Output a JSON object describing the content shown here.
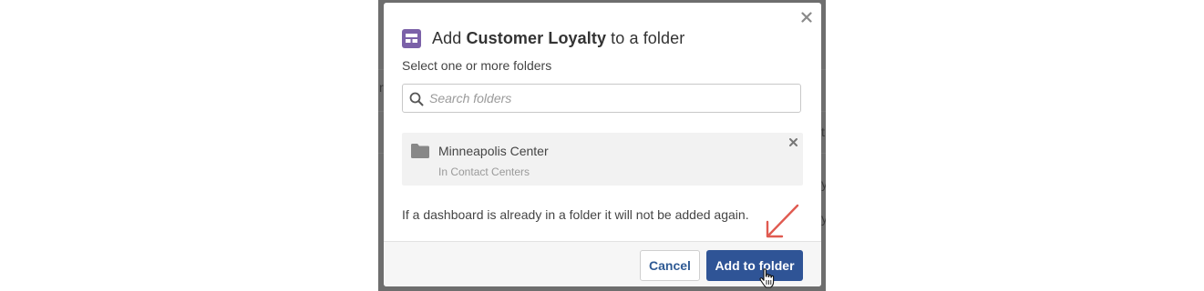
{
  "background": {
    "fragments": [
      "re",
      "t",
      "y",
      "y"
    ]
  },
  "modal": {
    "title_prefix": "Add ",
    "title_bold": "Customer Loyalty",
    "title_suffix": " to a folder",
    "icon": "dashboard-icon",
    "subtitle": "Select one or more folders",
    "search": {
      "placeholder": "Search folders",
      "value": ""
    },
    "selected_folders": [
      {
        "name": "Minneapolis Center",
        "path": "In Contact Centers"
      }
    ],
    "note": "If a dashboard is already in a folder it will not be added again.",
    "buttons": {
      "cancel": "Cancel",
      "add": "Add to folder"
    }
  },
  "colors": {
    "primary": "#2f5496",
    "icon_purple": "#7b61a8",
    "annotation_arrow": "#e05a50"
  }
}
